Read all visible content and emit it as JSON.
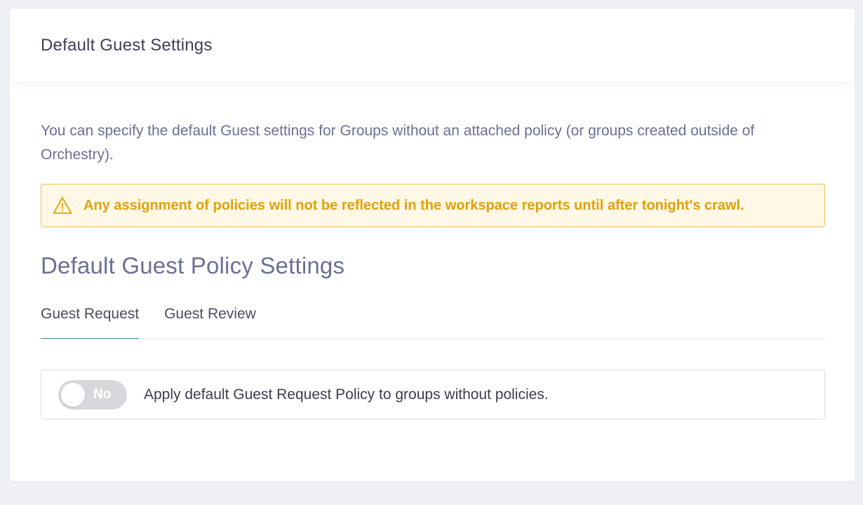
{
  "header": {
    "title": "Default Guest Settings"
  },
  "intro": {
    "text": "You can specify the default Guest settings for Groups without an attached policy (or groups created outside of Orchestry)."
  },
  "warning": {
    "icon": "warning-triangle-icon",
    "text": "Any assignment of policies will not be reflected in the workspace reports until after tonight's crawl."
  },
  "section": {
    "title": "Default Guest Policy Settings"
  },
  "tabs": [
    {
      "label": "Guest Request",
      "active": true
    },
    {
      "label": "Guest Review",
      "active": false
    }
  ],
  "toggle_row": {
    "state": "No",
    "enabled": false,
    "label": "Apply default Guest Request Policy to groups without policies."
  },
  "colors": {
    "warning_text": "#e3a008",
    "warning_bg": "#fff8e6",
    "warning_border": "#f2c14e",
    "active_tab_underline": "#3c8f93",
    "muted_text": "#6b6f96"
  }
}
